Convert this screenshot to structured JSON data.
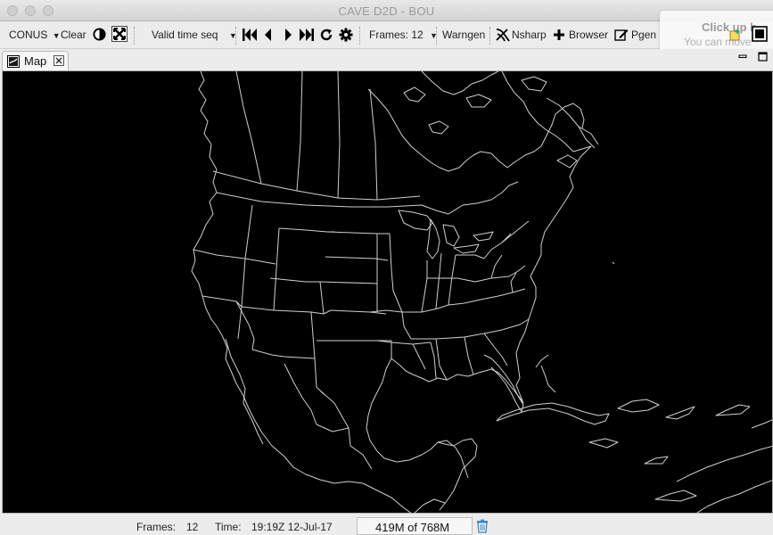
{
  "window": {
    "title": "CAVE D2D - BOU"
  },
  "toolbar": {
    "scale": "CONUS",
    "clear": "Clear",
    "time_mode": "Valid time seq",
    "frames_label": "Frames: 12",
    "warngen": "Warngen",
    "nsharp": "Nsharp",
    "browser": "Browser",
    "pgen": "Pgen"
  },
  "tooltip": {
    "title": "Click up h",
    "subtitle": "You can move"
  },
  "tab": {
    "label": "Map"
  },
  "status": {
    "frames_label": "Frames:",
    "frames_value": "12",
    "time_label": "Time:",
    "time_value": "19:19Z 12-Jul-17",
    "memory": "419M of 768M"
  },
  "icons": [
    "contrast-icon",
    "zoom-fit-icon",
    "first-frame-icon",
    "previous-frame-icon",
    "next-frame-icon",
    "last-frame-icon",
    "loop-icon",
    "settings-gear-icon",
    "nsharp-icon",
    "add-icon",
    "pgen-edit-icon",
    "map-tab-icon",
    "close-tab-icon",
    "minimize-icon",
    "maximize-icon",
    "trash-icon"
  ],
  "colors": {
    "map_background": "#000000",
    "map_lines": "#cfcfcf"
  }
}
